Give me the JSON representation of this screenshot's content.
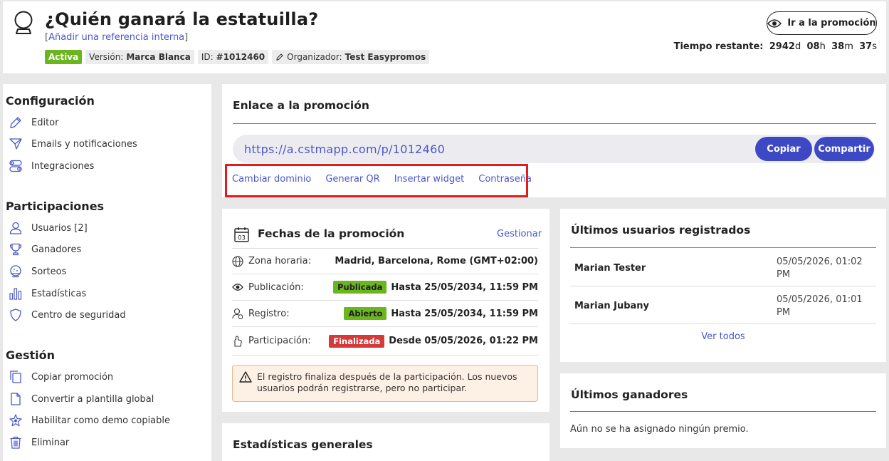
{
  "header": {
    "title": "¿Quién ganará la estatuilla?",
    "ref_open": "[",
    "ref_link": "Añadir una referencia interna",
    "ref_close": "]",
    "status": "Activa",
    "version_label": "Versión:",
    "version_value": "Marca Blanca",
    "id_label": "ID:",
    "id_value": "#1012460",
    "organizer_label": "Organizador:",
    "organizer_value": "Test Easypromos",
    "go_button": "Ir a la promoción",
    "countdown_label": "Tiempo restante:",
    "countdown_days": "2942",
    "countdown_hours": "08",
    "countdown_minutes": "38",
    "countdown_seconds": "37",
    "unit_d": "d",
    "unit_h": "h",
    "unit_m": "m",
    "unit_s": "s"
  },
  "sidebar": {
    "config_title": "Configuración",
    "config_items": [
      {
        "label": "Editor",
        "icon": "pencil-icon"
      },
      {
        "label": "Emails y notificaciones",
        "icon": "send-icon"
      },
      {
        "label": "Integraciones",
        "icon": "toggles-icon"
      }
    ],
    "participations_title": "Participaciones",
    "participations_items": [
      {
        "label": "Usuarios [2]",
        "icon": "user-icon"
      },
      {
        "label": "Ganadores",
        "icon": "trophy-icon"
      },
      {
        "label": "Sorteos",
        "icon": "raffle-icon"
      },
      {
        "label": "Estadísticas",
        "icon": "bar-chart-icon"
      },
      {
        "label": "Centro de seguridad",
        "icon": "shield-icon"
      }
    ],
    "management_title": "Gestión",
    "management_items": [
      {
        "label": "Copiar promoción",
        "icon": "copy-icon"
      },
      {
        "label": "Convertir a plantilla global",
        "icon": "file-icon"
      },
      {
        "label": "Habilitar como demo copiable",
        "icon": "star-icon"
      },
      {
        "label": "Eliminar",
        "icon": "trash-icon"
      }
    ]
  },
  "link": {
    "title": "Enlace a la promoción",
    "url": "https://a.cstmapp.com/p/1012460",
    "copy_button": "Copiar",
    "share_button": "Compartir",
    "actions": [
      "Cambiar dominio",
      "Generar QR",
      "Insertar widget",
      "Contraseña"
    ],
    "highlight_color": "#e31b1b"
  },
  "dates": {
    "calendar_day": "03",
    "title": "Fechas de la promoción",
    "manage": "Gestionar",
    "rows": [
      {
        "label": "Zona horaria:",
        "pill": "",
        "value": "Madrid, Barcelona, Rome (GMT+02:00)",
        "icon": "globe-icon"
      },
      {
        "label": "Publicación:",
        "pill": "Publicada",
        "value": "Hasta 25/05/2034, 11:59 PM",
        "icon": "eye-icon"
      },
      {
        "label": "Registro:",
        "pill": "Abierto",
        "value": "Hasta 25/05/2034, 11:59 PM",
        "icon": "user-register-icon"
      },
      {
        "label": "Participación:",
        "pill": "Finalizada",
        "value": "Desde 05/05/2026, 01:22 PM",
        "icon": "hand-icon"
      }
    ],
    "warning": "El registro finaliza después de la participación. Los nuevos usuarios podrán registrarse, pero no participar."
  },
  "stats": {
    "title": "Estadísticas generales"
  },
  "users": {
    "title": "Últimos usuarios registrados",
    "rows": [
      {
        "name": "Marian Tester",
        "date": "05/05/2026, 01:02 PM"
      },
      {
        "name": "Marian Jubany",
        "date": "05/05/2026, 01:01 PM"
      }
    ],
    "see_all": "Ver todos"
  },
  "winners": {
    "title": "Últimos ganadores",
    "empty": "Aún no se ha asignado ningún premio."
  },
  "colors": {
    "accent": "#3d48c4",
    "link": "#4a57c7",
    "success": "#6bb61e",
    "danger": "#d43a3a"
  }
}
